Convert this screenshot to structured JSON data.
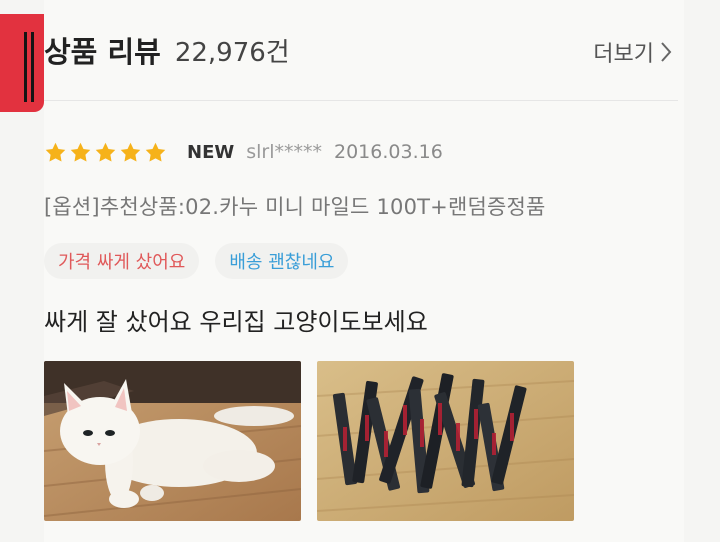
{
  "review_section": {
    "title": "상품 리뷰",
    "count": "22,976건",
    "more_label": "더보기",
    "more_icon": "chevron-right-icon"
  },
  "review": {
    "rating": 5,
    "rating_max": 5,
    "badge": "NEW",
    "user": "slrl*****",
    "date": "2016.03.16",
    "option": "[옵션]추천상품:02.카누 미니 마일드 100T+랜덤증정품",
    "tags": [
      {
        "label": "가격 싸게 샀어요",
        "color": "#e0595a"
      },
      {
        "label": "배송 괜찮네요",
        "color": "#3a9ed8"
      }
    ],
    "text": "싸게 잘 샀어요 우리집 고양이도보세요",
    "photos": [
      {
        "subject": "white-cat-photo"
      },
      {
        "subject": "coffee-sticks-photo"
      }
    ]
  },
  "colors": {
    "accent": "#e2323f",
    "star": "#f6b21a",
    "tag_price": "#e0595a",
    "tag_delivery": "#3a9ed8"
  }
}
